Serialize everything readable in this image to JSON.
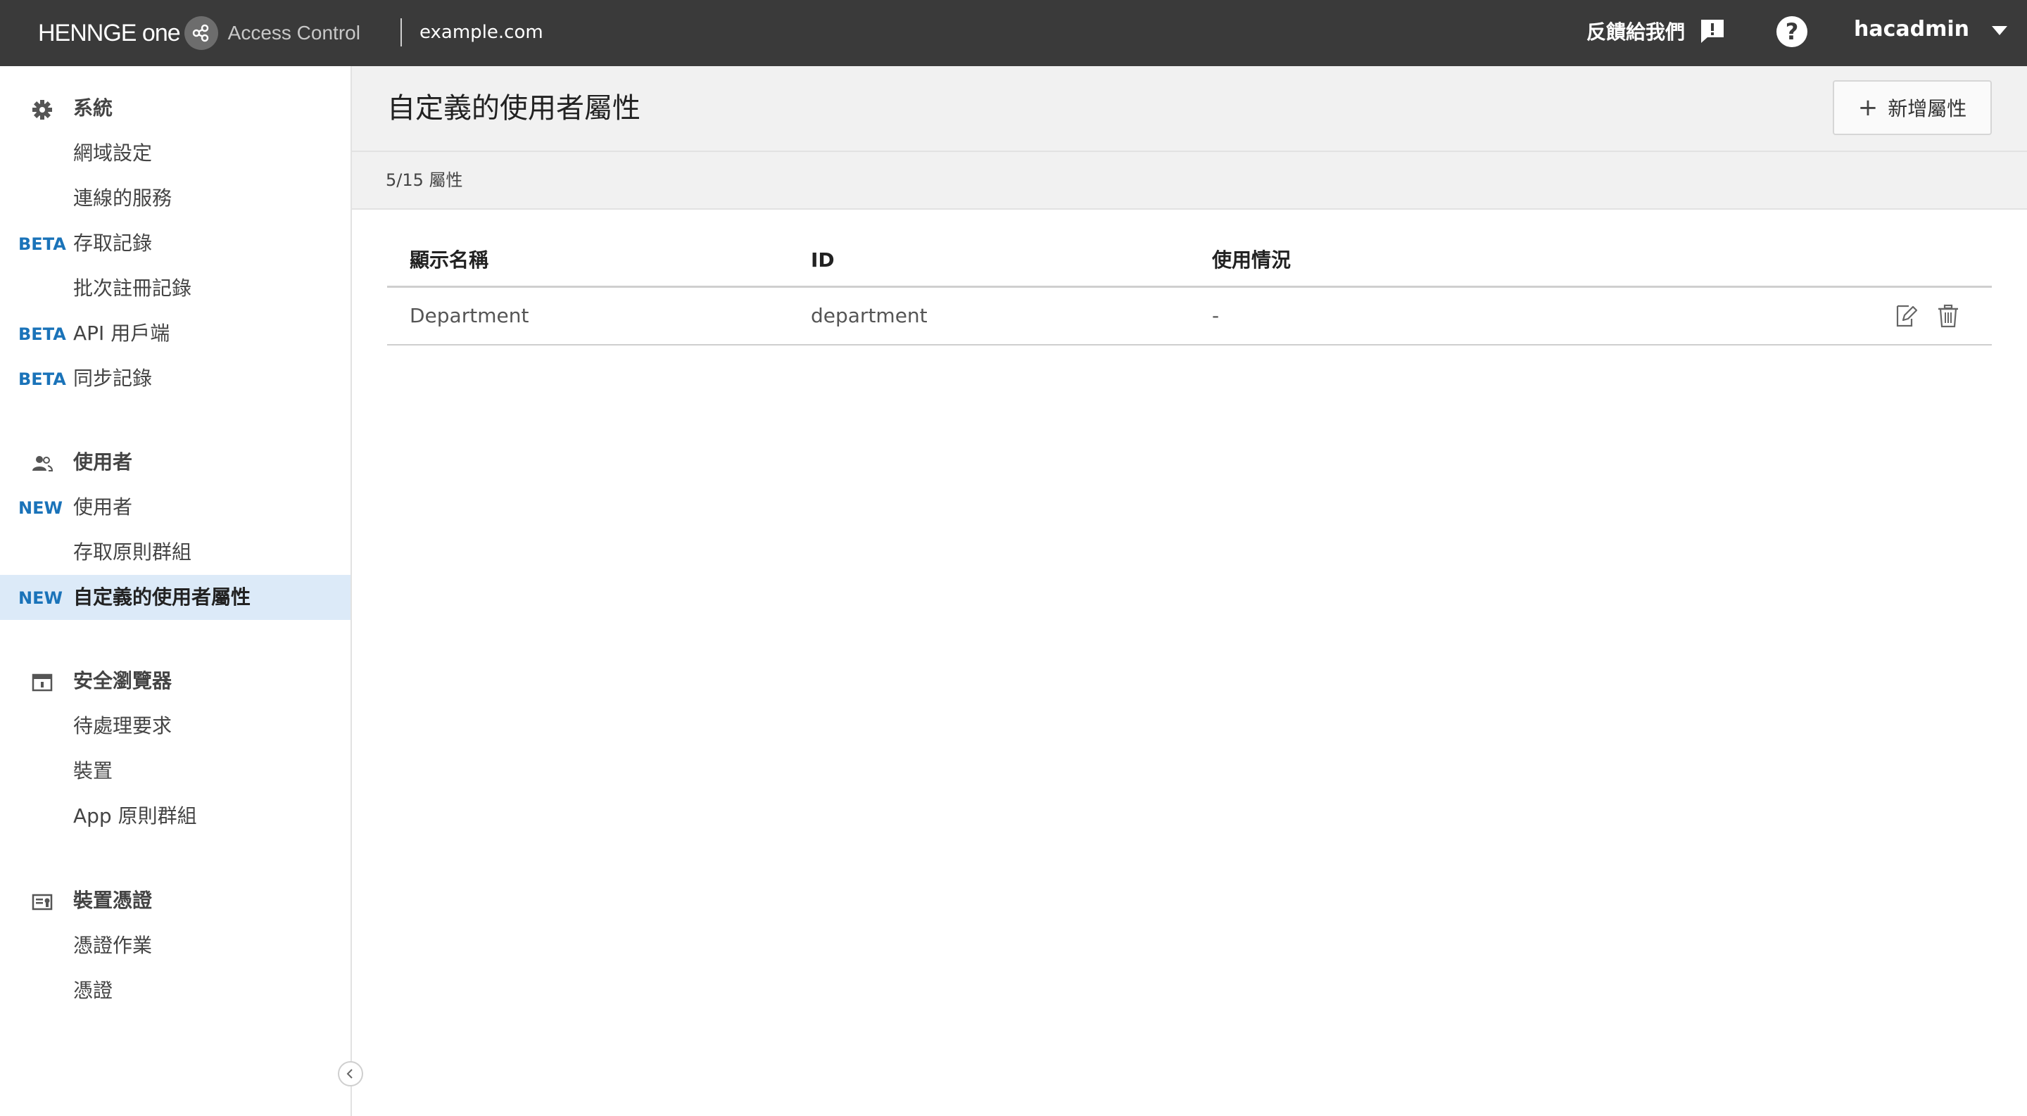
{
  "topbar": {
    "brand": "HENNGE one",
    "product": "Access Control",
    "domain": "example.com",
    "feedback_label": "反饋給我們",
    "help_symbol": "?",
    "username": "hacadmin"
  },
  "sidebar": {
    "groups": [
      {
        "title": "系統",
        "icon": "gear-icon",
        "items": [
          {
            "badge": "",
            "label": "網域設定"
          },
          {
            "badge": "",
            "label": "連線的服務"
          },
          {
            "badge": "BETA",
            "label": "存取記錄"
          },
          {
            "badge": "",
            "label": "批次註冊記錄"
          },
          {
            "badge": "BETA",
            "label": "API 用戶端"
          },
          {
            "badge": "BETA",
            "label": "同步記錄"
          }
        ]
      },
      {
        "title": "使用者",
        "icon": "users-icon",
        "items": [
          {
            "badge": "NEW",
            "label": "使用者"
          },
          {
            "badge": "",
            "label": "存取原則群組"
          },
          {
            "badge": "NEW",
            "label": "自定義的使用者屬性",
            "active": true
          }
        ]
      },
      {
        "title": "安全瀏覽器",
        "icon": "browser-icon",
        "items": [
          {
            "badge": "",
            "label": "待處理要求"
          },
          {
            "badge": "",
            "label": "裝置"
          },
          {
            "badge": "",
            "label": "App 原則群組"
          }
        ]
      },
      {
        "title": "裝置憑證",
        "icon": "certificate-icon",
        "items": [
          {
            "badge": "",
            "label": "憑證作業"
          },
          {
            "badge": "",
            "label": "憑證"
          }
        ]
      }
    ]
  },
  "main": {
    "title": "自定義的使用者屬性",
    "add_button_label": "新增屬性",
    "count_text": "5/15 屬性",
    "table": {
      "columns": [
        "顯示名稱",
        "ID",
        "使用情況"
      ],
      "rows": [
        {
          "name": "Department",
          "id": "department",
          "usage": "-"
        }
      ]
    }
  },
  "colors": {
    "topbar_bg": "#3a3a3a",
    "badge": "#1a73b9",
    "active_bg": "#dceaf8"
  }
}
